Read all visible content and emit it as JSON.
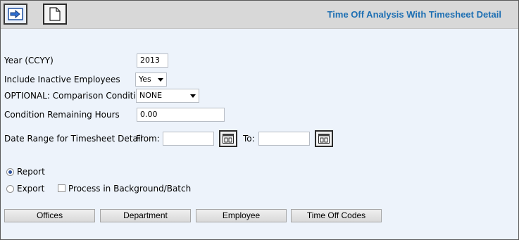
{
  "window": {
    "title": "Time Off Analysis With Timesheet Detail",
    "toolbar": {
      "run_icon": "arrow-right-icon",
      "new_icon": "document-icon"
    }
  },
  "form": {
    "year": {
      "label": "Year (CCYY)",
      "value": "2013"
    },
    "include_inactive": {
      "label": "Include Inactive Employees",
      "value": "Yes"
    },
    "comparison": {
      "label": "OPTIONAL: Comparison Condition",
      "value": "NONE"
    },
    "remaining_hours": {
      "label": "Condition Remaining Hours",
      "value": "0.00"
    },
    "date_range": {
      "label": "Date Range for Timesheet Detail",
      "from_label": "From:",
      "from_value": "",
      "to_label": "To:",
      "to_value": ""
    }
  },
  "output": {
    "report_label": "Report",
    "export_label": "Export",
    "background_label": "Process in Background/Batch",
    "selected": "Report"
  },
  "buttons": {
    "offices": "Offices",
    "department": "Department",
    "employee": "Employee",
    "time_off_codes": "Time Off Codes"
  },
  "colors": {
    "title": "#1d6fb3",
    "background": "#edf3fb",
    "toolbar": "#d8d8d8"
  }
}
